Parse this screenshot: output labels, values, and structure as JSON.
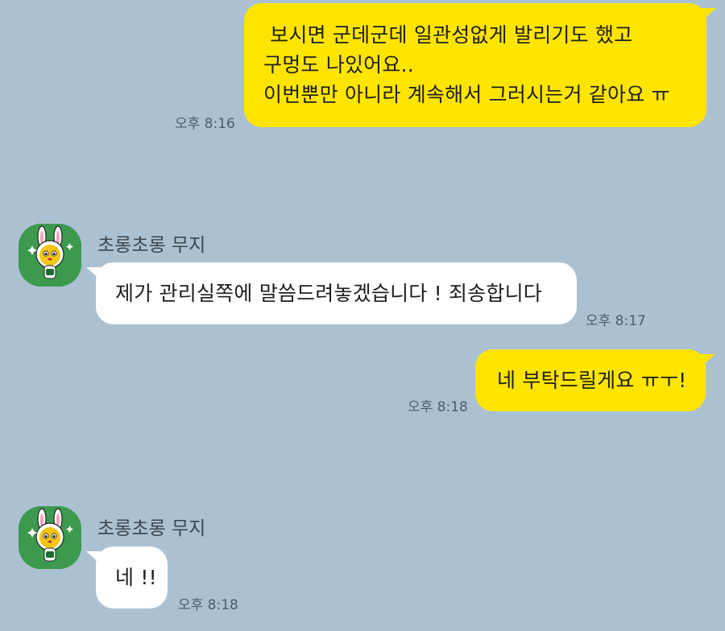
{
  "messages": [
    {
      "sender": "me",
      "text": " 보시면 군데군데 일관성없게 발리기도 했고\n구멍도 나있어요..\n이번뿐만 아니라 계속해서 그러시는거 같아요 ㅠ",
      "time": "오후 8:16"
    },
    {
      "sender": "other",
      "name": "초롱초롱 무지",
      "text": "제가 관리실쪽에 말씀드려놓겠습니다 ! 죄송합니다",
      "time": "오후 8:17"
    },
    {
      "sender": "me",
      "text": "네 부탁드릴게요 ㅠㅜ!",
      "time": "오후 8:18"
    },
    {
      "sender": "other",
      "name": "초롱초롱 무지",
      "text": "네 !!",
      "time": "오후 8:18"
    }
  ],
  "colors": {
    "background": "#abc1d1",
    "my_bubble": "#fee500",
    "their_bubble": "#ffffff",
    "avatar_bg": "#3c9a4e"
  },
  "icons": {
    "avatar": "muzi-rabbit-avatar-icon"
  }
}
